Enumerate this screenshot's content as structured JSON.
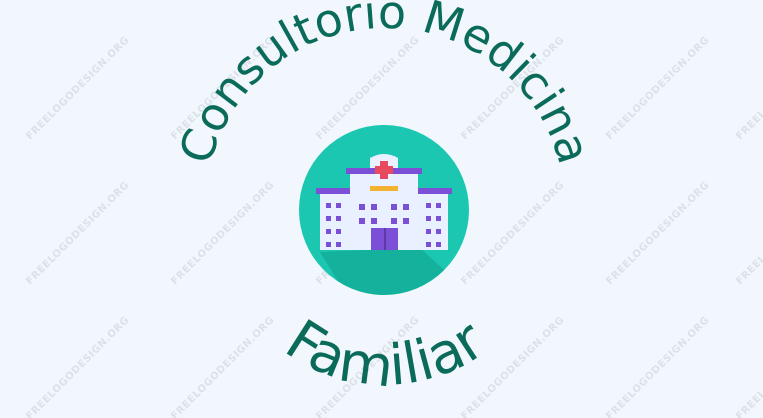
{
  "logo": {
    "top_text": "Consultorio Medicina",
    "bottom_text": "Familiar",
    "icon": "hospital-building-icon",
    "colors": {
      "background": "#f1f7fc",
      "text": "#0b6b5a",
      "circle": "#1bc7b1",
      "shadow": "#0e9f8c",
      "building_main": "#e9f0ff",
      "building_purple": "#7b4fd6",
      "cross": "#e74a5e",
      "accent": "#f3b232"
    }
  },
  "watermark": {
    "text": "FREELOGODESIGN.ORG"
  }
}
